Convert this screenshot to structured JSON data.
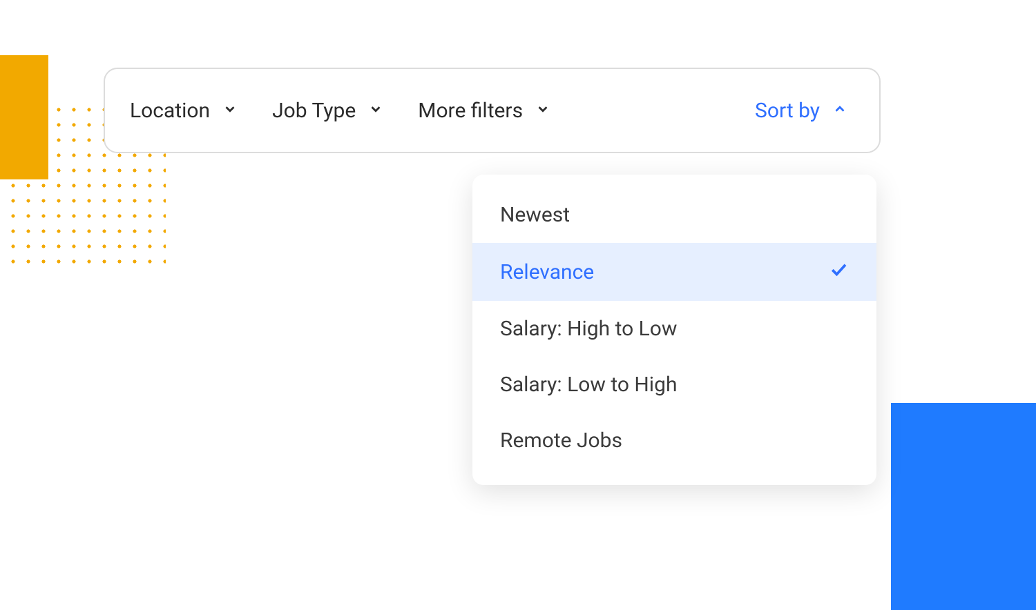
{
  "filters": {
    "location": {
      "label": "Location"
    },
    "jobType": {
      "label": "Job Type"
    },
    "moreFilters": {
      "label": "More filters"
    }
  },
  "sort": {
    "label": "Sort by",
    "options": [
      {
        "label": "Newest",
        "selected": false
      },
      {
        "label": "Relevance",
        "selected": true
      },
      {
        "label": "Salary: High to Low",
        "selected": false
      },
      {
        "label": "Salary: Low to High",
        "selected": false
      },
      {
        "label": "Remote Jobs",
        "selected": false
      }
    ]
  }
}
